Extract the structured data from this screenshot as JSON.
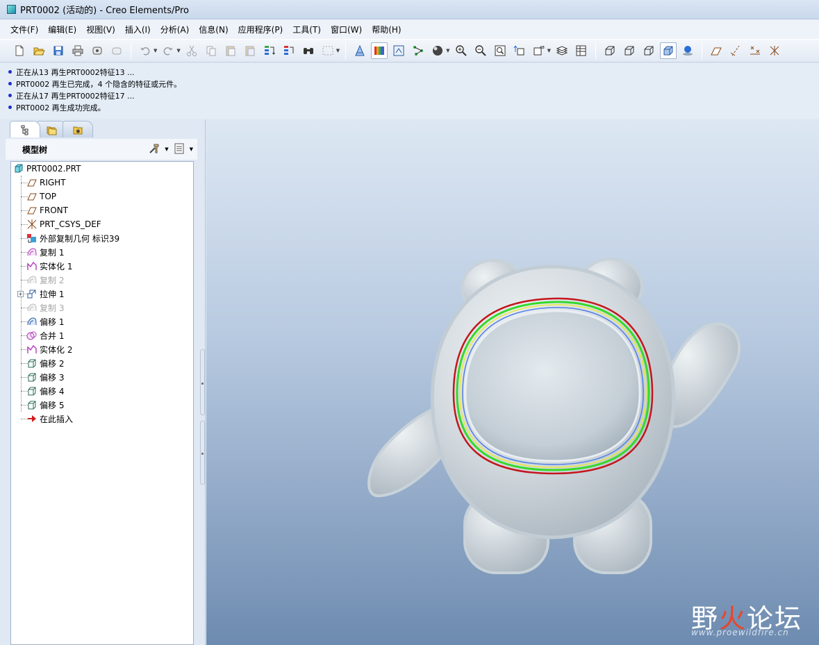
{
  "window": {
    "title": "PRT0002 (活动的) - Creo Elements/Pro"
  },
  "menu": {
    "items": [
      "文件(F)",
      "编辑(E)",
      "视图(V)",
      "插入(I)",
      "分析(A)",
      "信息(N)",
      "应用程序(P)",
      "工具(T)",
      "窗口(W)",
      "帮助(H)"
    ]
  },
  "toolbar": {
    "icons": [
      "new-icon",
      "open-icon",
      "save-icon",
      "print-icon",
      "send-icon",
      "email-icon",
      "undo-icon",
      "redo-icon",
      "cut-icon",
      "copy-icon",
      "paste-icon",
      "paste-special-icon",
      "regenerate-icon",
      "regen-manager-icon",
      "find-icon",
      "select-box-icon",
      "measure-icon",
      "color-appearance-icon",
      "model-display-icon",
      "datum-display-icon",
      "spin-center-icon",
      "zoom-in-icon",
      "zoom-out-icon",
      "refit-icon",
      "reorient-icon",
      "saved-views-icon",
      "layers-icon",
      "view-manager-icon",
      "wireframe-icon",
      "hidden-line-icon",
      "no-hidden-icon",
      "shading-icon",
      "enhanced-realism-icon",
      "plane-display-icon",
      "axis-display-icon",
      "point-display-icon",
      "csys-display-icon"
    ]
  },
  "messages": [
    "正在从13 再生PRT0002特征13 ...",
    "PRT0002 再生已完成，4 个隐含的特征或元件。",
    "正在从17 再生PRT0002特征17 ...",
    "PRT0002 再生成功完成。"
  ],
  "left_panel": {
    "tree_title": "模型树",
    "root": "PRT0002.PRT",
    "items": [
      {
        "label": "RIGHT",
        "icon": "datum-plane-icon",
        "suppressed": false
      },
      {
        "label": "TOP",
        "icon": "datum-plane-icon",
        "suppressed": false
      },
      {
        "label": "FRONT",
        "icon": "datum-plane-icon",
        "suppressed": false
      },
      {
        "label": "PRT_CSYS_DEF",
        "icon": "csys-icon",
        "suppressed": false
      },
      {
        "label": "外部复制几何 标识39",
        "icon": "external-copy-geom-icon",
        "suppressed": false
      },
      {
        "label": "复制 1",
        "icon": "copy-surface-icon",
        "suppressed": false
      },
      {
        "label": "实体化 1",
        "icon": "solidify-icon",
        "suppressed": false
      },
      {
        "label": "复制 2",
        "icon": "copy-surface-icon",
        "suppressed": true
      },
      {
        "label": "拉伸 1",
        "icon": "extrude-icon",
        "suppressed": false,
        "expandable": true
      },
      {
        "label": "复制 3",
        "icon": "copy-surface-icon",
        "suppressed": true
      },
      {
        "label": "偏移 1",
        "icon": "offset-surface-icon",
        "suppressed": false
      },
      {
        "label": "合并 1",
        "icon": "merge-icon",
        "suppressed": false
      },
      {
        "label": "实体化 2",
        "icon": "solidify-icon",
        "suppressed": false
      },
      {
        "label": "偏移 2",
        "icon": "offset-solid-icon",
        "suppressed": false
      },
      {
        "label": "偏移 3",
        "icon": "offset-solid-icon",
        "suppressed": false
      },
      {
        "label": "偏移 4",
        "icon": "offset-solid-icon",
        "suppressed": false
      },
      {
        "label": "偏移 5",
        "icon": "offset-solid-icon",
        "suppressed": false
      },
      {
        "label": "在此插入",
        "icon": "insert-here-arrow-icon",
        "suppressed": false
      }
    ]
  },
  "watermark": {
    "brand_left": "野",
    "brand_fire": "火",
    "brand_right": "论坛",
    "url": "www.proewildfire.cn"
  },
  "colors": {
    "suppressed_text": "#a6a6a6",
    "message_bullet": "#1b2fc9",
    "edge_red": "#c4161c",
    "edge_green": "#35d92a",
    "edge_yellow": "#e8ea3a",
    "edge_blue": "#4f7ee8"
  }
}
